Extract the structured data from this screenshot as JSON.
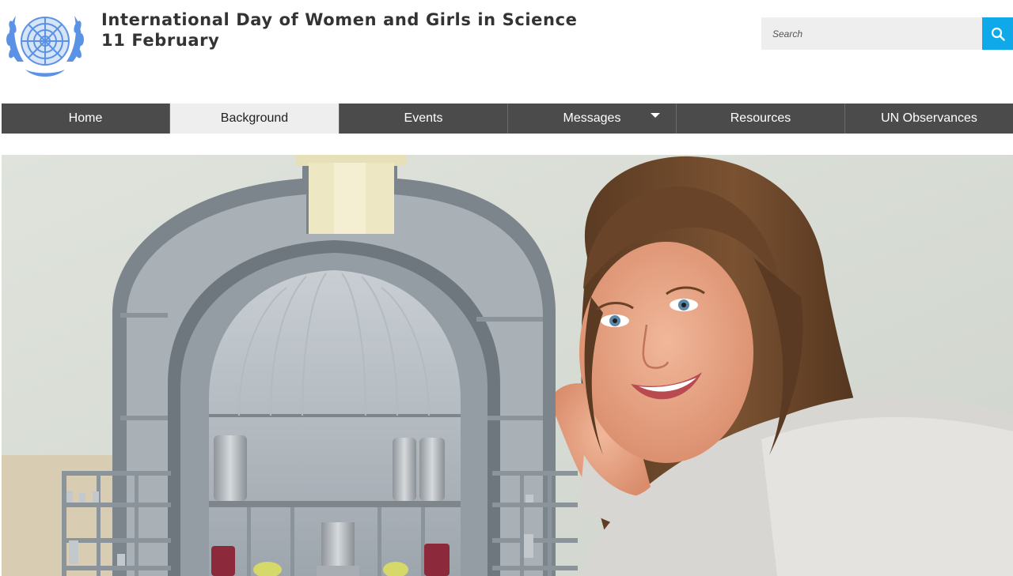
{
  "header": {
    "logo_icon": "un-emblem-icon",
    "title_line1": "International Day of Women and Girls in Science",
    "title_line2": "11 February"
  },
  "search": {
    "placeholder": "Search",
    "button_icon": "search-icon"
  },
  "nav": {
    "items": [
      {
        "label": "Home"
      },
      {
        "label": "Background"
      },
      {
        "label": "Events"
      },
      {
        "label": "Messages"
      },
      {
        "label": "Resources"
      },
      {
        "label": "UN Observances"
      }
    ],
    "active": "Background",
    "dropdown_icon": "caret-down-icon"
  },
  "colors": {
    "un_blue": "#5b92e5",
    "nav_bg": "#4b4b4b",
    "nav_active_bg": "#eeeeee",
    "search_button": "#0fa9e9",
    "title_text": "#333333"
  }
}
